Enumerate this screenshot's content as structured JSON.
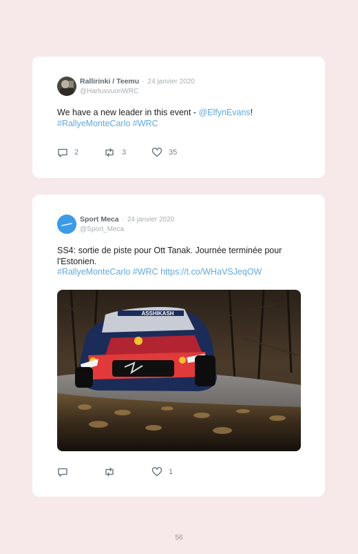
{
  "tweets": [
    {
      "name": "Rallirinki / Teemu",
      "separator": "·",
      "date": "24 janvier 2020",
      "handle": "@HartusvuoriWRC",
      "text_prefix": "We have a new leader in this event - ",
      "mention": "@ElfynEvans",
      "text_suffix": "!",
      "hashtag1": "#RallyeMonteCarlo",
      "hashtag2": "#WRC",
      "replies": "2",
      "retweets": "3",
      "likes": "35"
    },
    {
      "name": "Sport Meca",
      "separator": "·",
      "date": "24 janvier 2020",
      "handle": "@Sport_Meca",
      "text": "SS4: sortie de piste pour Ott Tanak. Journée terminée pour l'Estonien.",
      "hashtag1": "#RallyeMonteCarlo",
      "hashtag2": "#WRC",
      "url": "https://t.co/WHaVSJeqOW",
      "replies": "",
      "retweets": "",
      "likes": "1",
      "image_sponsor_text": "ASSHIKASH"
    }
  ],
  "page_number": "56",
  "colors": {
    "page_background": "#f7e8e9",
    "card_background": "#ffffff",
    "link": "#61a8e0",
    "meta_text": "#a7adb2"
  },
  "icons": [
    "reply-icon",
    "retweet-icon",
    "heart-icon"
  ]
}
